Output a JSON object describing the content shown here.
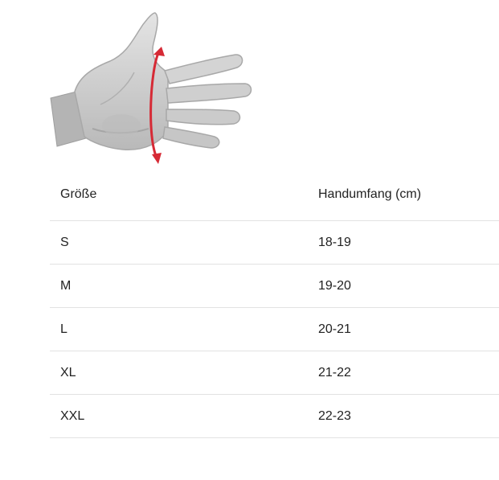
{
  "illustration": {
    "name": "hand-circumference-diagram",
    "hand_color": "#c8c8c8",
    "measure_color": "#d62a35"
  },
  "table": {
    "headers": {
      "size": "Größe",
      "circumference": "Handumfang (cm)"
    },
    "rows": [
      {
        "size": "S",
        "circumference": "18-19"
      },
      {
        "size": "M",
        "circumference": "19-20"
      },
      {
        "size": "L",
        "circumference": "20-21"
      },
      {
        "size": "XL",
        "circumference": "21-22"
      },
      {
        "size": "XXL",
        "circumference": "22-23"
      }
    ]
  }
}
